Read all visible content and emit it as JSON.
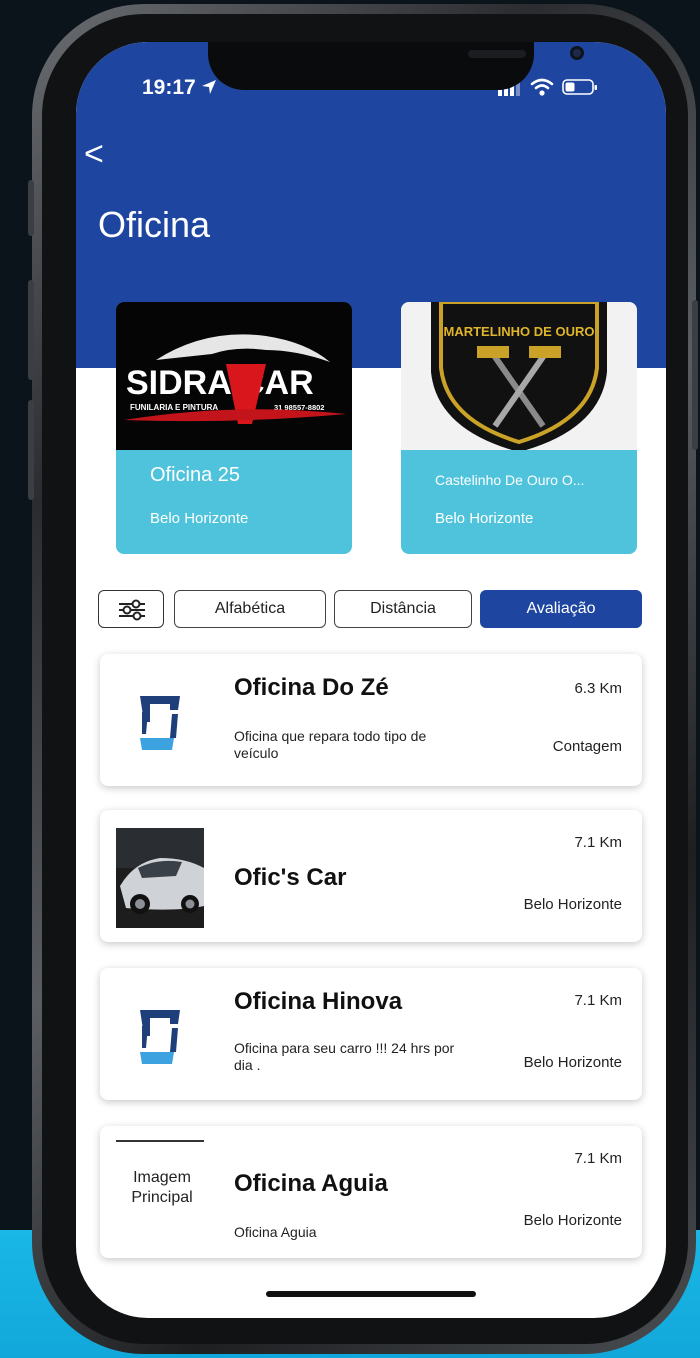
{
  "status_bar": {
    "time": "19:17"
  },
  "header": {
    "back_label": "<",
    "title": "Oficina"
  },
  "featured": [
    {
      "logo_text": "SIDRA CAR",
      "logo_sub": "FUNILARIA E PINTURA",
      "logo_phone": "31 98557-8802",
      "name": "Oficina 25",
      "city": "Belo Horizonte"
    },
    {
      "logo_text": "MARTELINHO DE OURO",
      "name": "Castelinho De Ouro O...",
      "city": "Belo Horizonte"
    }
  ],
  "filters": {
    "options": [
      "Alfabética",
      "Distância",
      "Avaliação"
    ],
    "selected": "Avaliação"
  },
  "list": [
    {
      "title": "Oficina Do Zé",
      "description": "Oficina que repara todo tipo de veículo",
      "distance": "6.3 Km",
      "city": "Contagem"
    },
    {
      "title": "Ofic's Car",
      "description": "",
      "distance": "7.1 Km",
      "city": "Belo Horizonte"
    },
    {
      "title": "Oficina Hinova",
      "description": "Oficina para seu carro !!! 24 hrs por dia .",
      "distance": "7.1 Km",
      "city": "Belo Horizonte"
    },
    {
      "title": "Oficina Aguia",
      "description": "Oficina Aguia",
      "distance": "7.1 Km",
      "city": "Belo Horizonte",
      "image_placeholder": "Imagem Principal"
    }
  ],
  "colors": {
    "primary": "#1e46a0",
    "featured_card": "#4fc3dc",
    "thumb_dark": "#1e3f7a",
    "thumb_light": "#3da3e0"
  }
}
